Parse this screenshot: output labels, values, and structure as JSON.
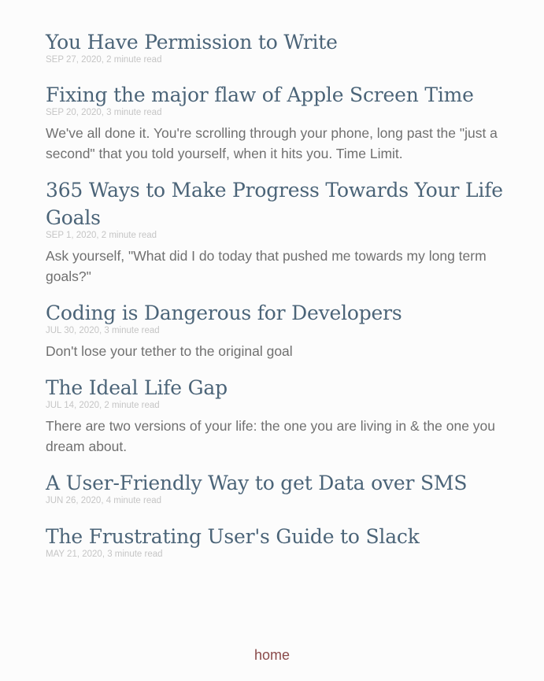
{
  "posts": [
    {
      "title": "You Have Permission to Write",
      "meta": "SEP 27, 2020, 2 minute read",
      "excerpt": ""
    },
    {
      "title": "Fixing the major flaw of Apple Screen Time",
      "meta": "SEP 20, 2020, 3 minute read",
      "excerpt": "We've all done it. You're scrolling through your phone, long past the \"just a second\" that you told yourself, when it hits you. Time Limit."
    },
    {
      "title": "365 Ways to Make Progress Towards Your Life Goals",
      "meta": "SEP 1, 2020, 2 minute read",
      "excerpt": "Ask yourself, \"What did I do today that pushed me towards my long term goals?\""
    },
    {
      "title": "Coding is Dangerous for Developers",
      "meta": "JUL 30, 2020, 3 minute read",
      "excerpt": "Don't lose your tether to the original goal"
    },
    {
      "title": "The Ideal Life Gap",
      "meta": "JUL 14, 2020, 2 minute read",
      "excerpt": "There are two versions of your life: the one you are living in & the one you dream about."
    },
    {
      "title": "A User-Friendly Way to get Data over SMS",
      "meta": "JUN 26, 2020, 4 minute read",
      "excerpt": ""
    },
    {
      "title": "The Frustrating User's Guide to Slack",
      "meta": "MAY 21, 2020, 3 minute read",
      "excerpt": ""
    }
  ],
  "footer": {
    "home_label": "home"
  },
  "colors": {
    "background": "#fcfcfc",
    "title": "#4b6478",
    "meta": "#c5c5c5",
    "excerpt": "#707070",
    "link": "#8a4b4b"
  }
}
